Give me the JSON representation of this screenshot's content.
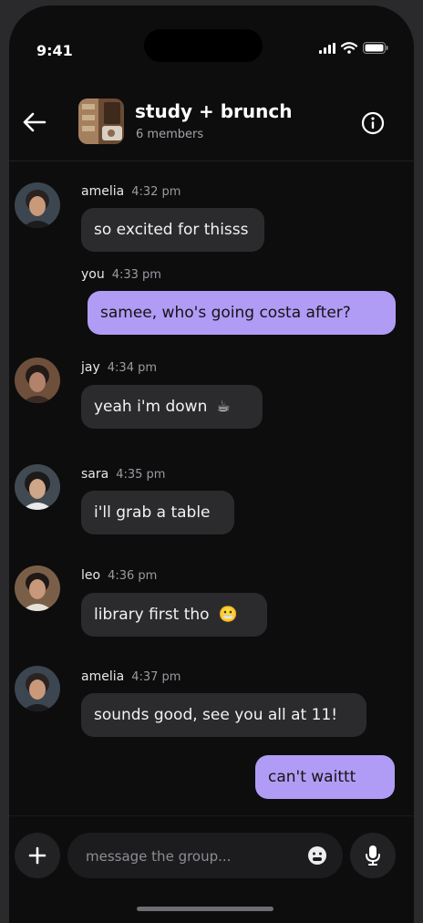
{
  "status_bar": {
    "time": "9:41"
  },
  "header": {
    "title": "study + brunch",
    "subtitle": "6 members"
  },
  "messages": [
    {
      "sender": "amelia",
      "time": "4:32 pm",
      "text": "so excited for thisss",
      "direction": "incoming"
    },
    {
      "sender": "you",
      "time": "4:33 pm",
      "text": "samee, who's going costa after?",
      "direction": "outgoing"
    },
    {
      "sender": "jay",
      "time": "4:34 pm",
      "text": "yeah i'm down",
      "emoji": "☕",
      "direction": "incoming"
    },
    {
      "sender": "sara",
      "time": "4:35 pm",
      "text": "i'll grab a table",
      "direction": "incoming"
    },
    {
      "sender": "leo",
      "time": "4:36 pm",
      "text": "library first tho",
      "emoji": "😬",
      "direction": "incoming"
    },
    {
      "sender": "amelia",
      "time": "4:37 pm",
      "text": "sounds good, see you all at 11!",
      "direction": "incoming"
    },
    {
      "text": "can't waittt",
      "direction": "outgoing"
    }
  ],
  "composer": {
    "placeholder": "message the group...",
    "value": ""
  },
  "colors": {
    "background": "#0d0d0e",
    "incoming_bubble": "#2b2b2e",
    "outgoing_bubble": "#b09cf5"
  },
  "icons": {
    "back": "back-arrow-icon",
    "info": "info-icon",
    "plus": "plus-icon",
    "emoji": "emoji-icon",
    "mic": "mic-icon",
    "signal": "signal-icon",
    "wifi": "wifi-icon",
    "battery": "battery-icon"
  }
}
